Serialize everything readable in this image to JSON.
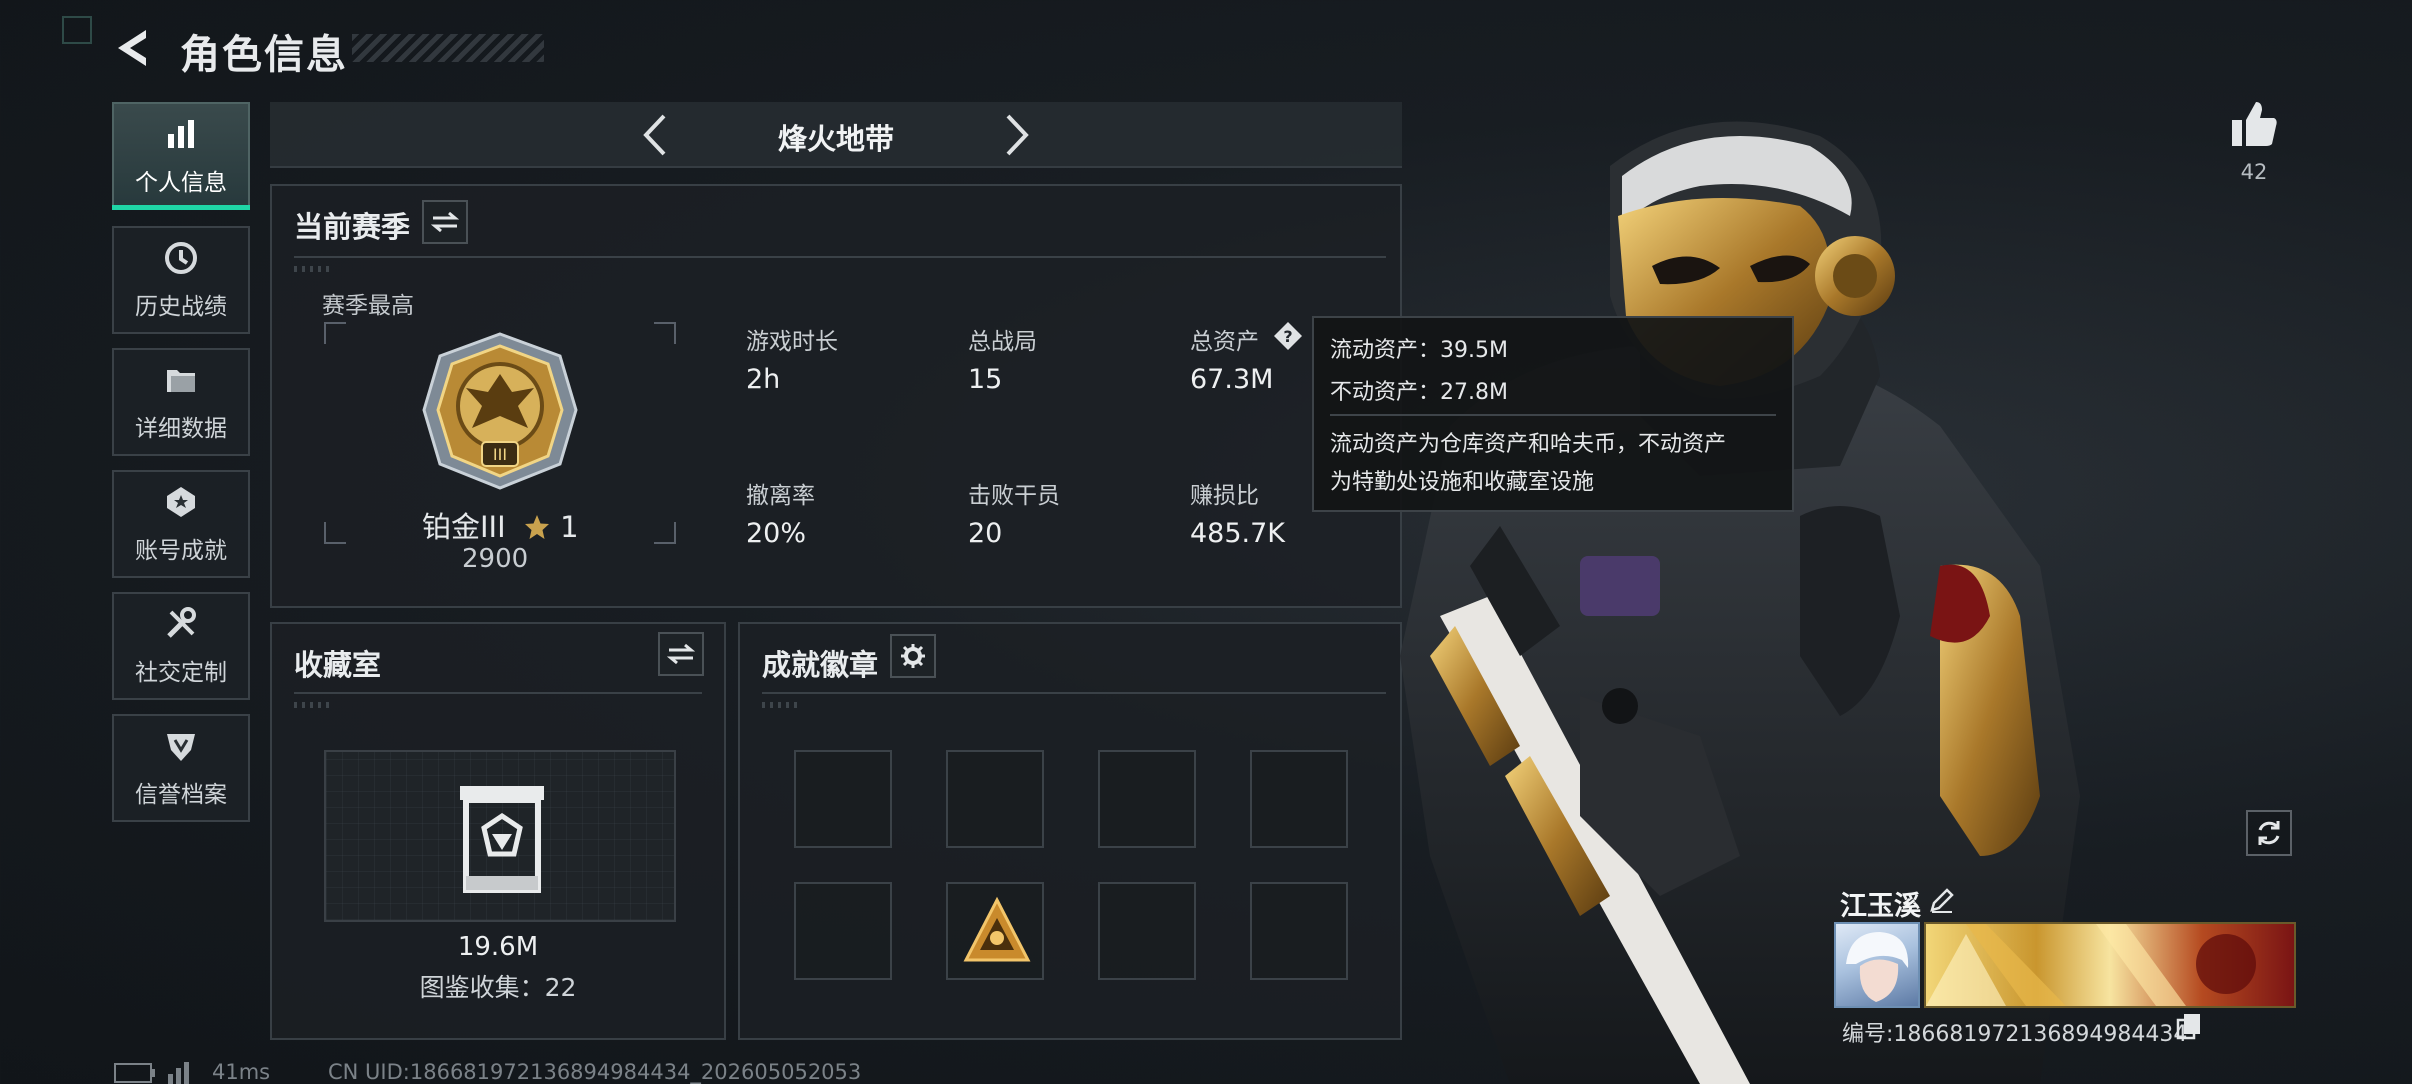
{
  "header": {
    "title": "角色信息"
  },
  "sidebar": {
    "items": [
      {
        "label": "个人信息",
        "icon": "bar-chart-icon",
        "active": true
      },
      {
        "label": "历史战绩",
        "icon": "history-icon"
      },
      {
        "label": "详细数据",
        "icon": "folder-icon"
      },
      {
        "label": "账号成就",
        "icon": "achievement-icon"
      },
      {
        "label": "社交定制",
        "icon": "tools-icon"
      },
      {
        "label": "信誉档案",
        "icon": "shield-icon"
      }
    ]
  },
  "mode": {
    "name": "烽火地带"
  },
  "season": {
    "title": "当前赛季",
    "best_label": "赛季最高",
    "rank": "铂金III",
    "stars": "1",
    "points": "2900",
    "stats": [
      {
        "label": "游戏时长",
        "value": "2h"
      },
      {
        "label": "总战局",
        "value": "15"
      },
      {
        "label": "总资产",
        "value": "67.3M"
      },
      {
        "label": "撤离率",
        "value": "20%"
      },
      {
        "label": "击败干员",
        "value": "20"
      },
      {
        "label": "赚损比",
        "value": "485.7K"
      }
    ]
  },
  "tooltip": {
    "liquid": "流动资产：39.5M",
    "fixed": "不动资产：27.8M",
    "desc_line1": "流动资产为仓库资产和哈夫币，不动资产",
    "desc_line2": "为特勤处设施和收藏室设施"
  },
  "collection": {
    "title": "收藏室",
    "value": "19.6M",
    "count": "图鉴收集：22"
  },
  "badges": {
    "title": "成就徽章"
  },
  "player": {
    "likes": "42",
    "nickname": "江玉溪",
    "id": "编号:186681972136894984434"
  },
  "footer": {
    "ping": "41ms",
    "uid": "CN UID:186681972136894984434_202605052053"
  },
  "colors": {
    "accent": "#1fd6a6",
    "gold": "#c9962e"
  }
}
